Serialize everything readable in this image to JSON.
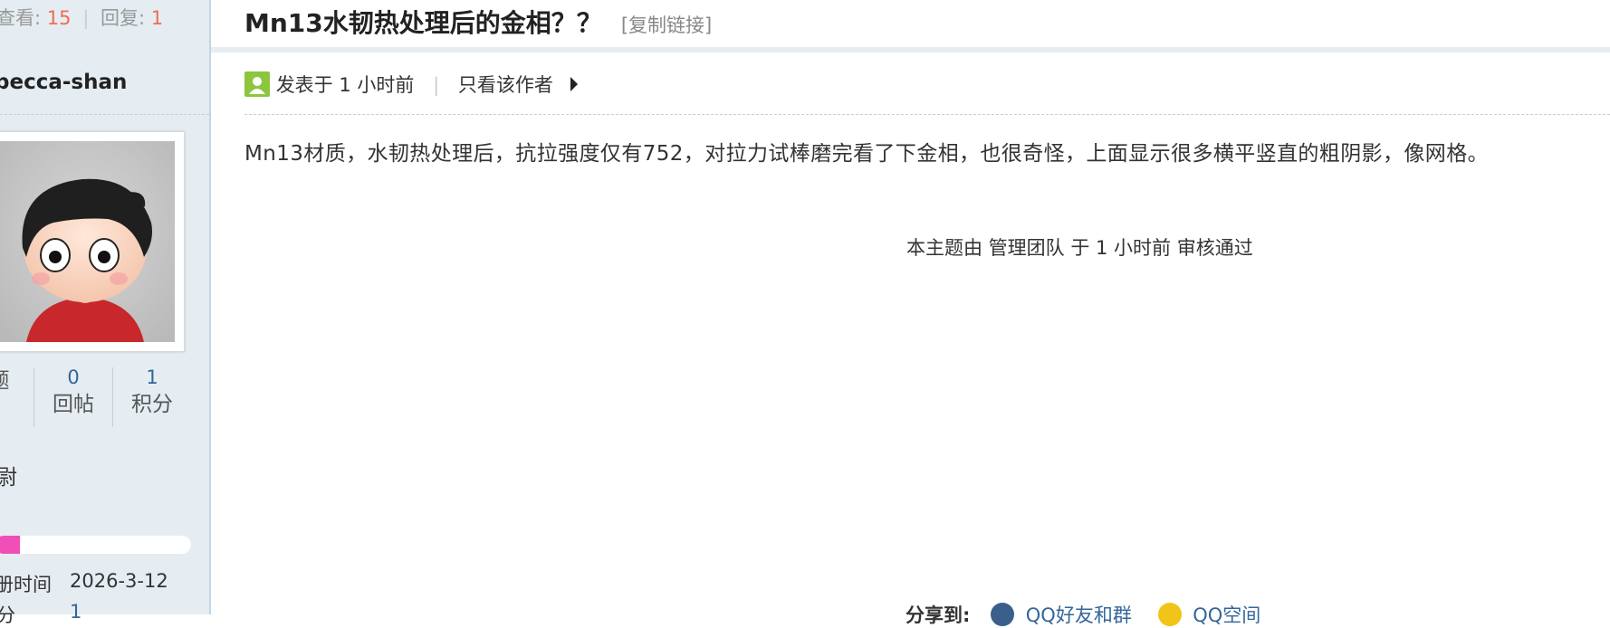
{
  "thread_stats": {
    "views_label": "查看:",
    "views": "15",
    "separator": "|",
    "replies_label": "回复:",
    "replies": "1"
  },
  "author": {
    "username": "becca-shan",
    "stats": [
      {
        "value": "",
        "label": "题"
      },
      {
        "value": "0",
        "label": "回帖"
      },
      {
        "value": "1",
        "label": "积分"
      }
    ],
    "rank_text": "尉",
    "level_progress_fraction": 0.13,
    "reg_label": "册时间",
    "reg_date": "2026-3-12",
    "credit_label": "分",
    "credit_value": "1"
  },
  "post": {
    "title": "Mn13水韧热处理后的金相？？",
    "copy_link": "[复制链接]",
    "posted": "发表于 1 小时前",
    "meta_separator": "|",
    "only_author": "只看该作者",
    "body": "Mn13材质，水韧热处理后，抗拉强度仅有752，对拉力试棒磨完看了下金相，也很奇怪，上面显示很多横平竖直的粗阴影，像网格。",
    "moderation": "本主题由 管理团队 于 1 小时前 审核通过"
  },
  "share": {
    "label": "分享到:",
    "items": [
      {
        "label": "QQ好友和群"
      },
      {
        "label": "QQ空间"
      }
    ]
  },
  "colors": {
    "sidebar_bg": "#e5edf2",
    "accent_orange": "#f26c4f",
    "link_blue": "#336699",
    "progress_pink": "#f14fb8"
  }
}
